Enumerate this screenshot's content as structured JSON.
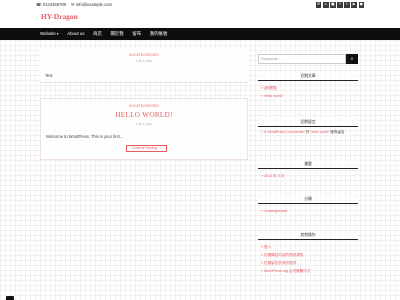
{
  "topbar": {
    "phone_icon": "phone-icon",
    "phone": "0123456789",
    "email_icon": "mail-icon",
    "email": "info@example.com",
    "social": [
      "✉",
      "⌂",
      "■",
      "f",
      "t",
      "▶",
      "●"
    ]
  },
  "header": {
    "site_title": "HY-Dragon"
  },
  "nav": {
    "items": [
      "Website",
      "About us",
      "商店",
      "關於我",
      "留布",
      "我的帳號"
    ]
  },
  "posts": [
    {
      "category": "UNCATEGORIZED",
      "meta": "8 月 8, 2018",
      "text": "Test"
    },
    {
      "category": "UNCATEGORIZED",
      "meta": "8 月 8, 2018",
      "title": "HELLO WORLD!",
      "excerpt": "Welcome to WordPress. This is your first...",
      "read_more": "Continue Reading →"
    }
  ],
  "sidebar": {
    "search_placeholder": "Keywords...",
    "search_button": "⌕",
    "recent_posts": {
      "title": "近期文章",
      "items": [
        "(無標題)",
        "Hello world!"
      ]
    },
    "recent_comments": {
      "title": "近期留言",
      "author": "A WordPress Commenter",
      "mid": " 於 ",
      "post": "Hello world!",
      "tail": " 發佈留言"
    },
    "archives": {
      "title": "彙整",
      "items": [
        "2018 年 8 月"
      ]
    },
    "categories": {
      "title": "分類",
      "items": [
        "Uncategorized"
      ]
    },
    "meta": {
      "title": "其他操作",
      "items": [
        "登入",
        "訂閱網站內容的資訊提供",
        "訂閱留言的資訊提供",
        "WordPress.org 台灣繁體中文"
      ]
    }
  }
}
